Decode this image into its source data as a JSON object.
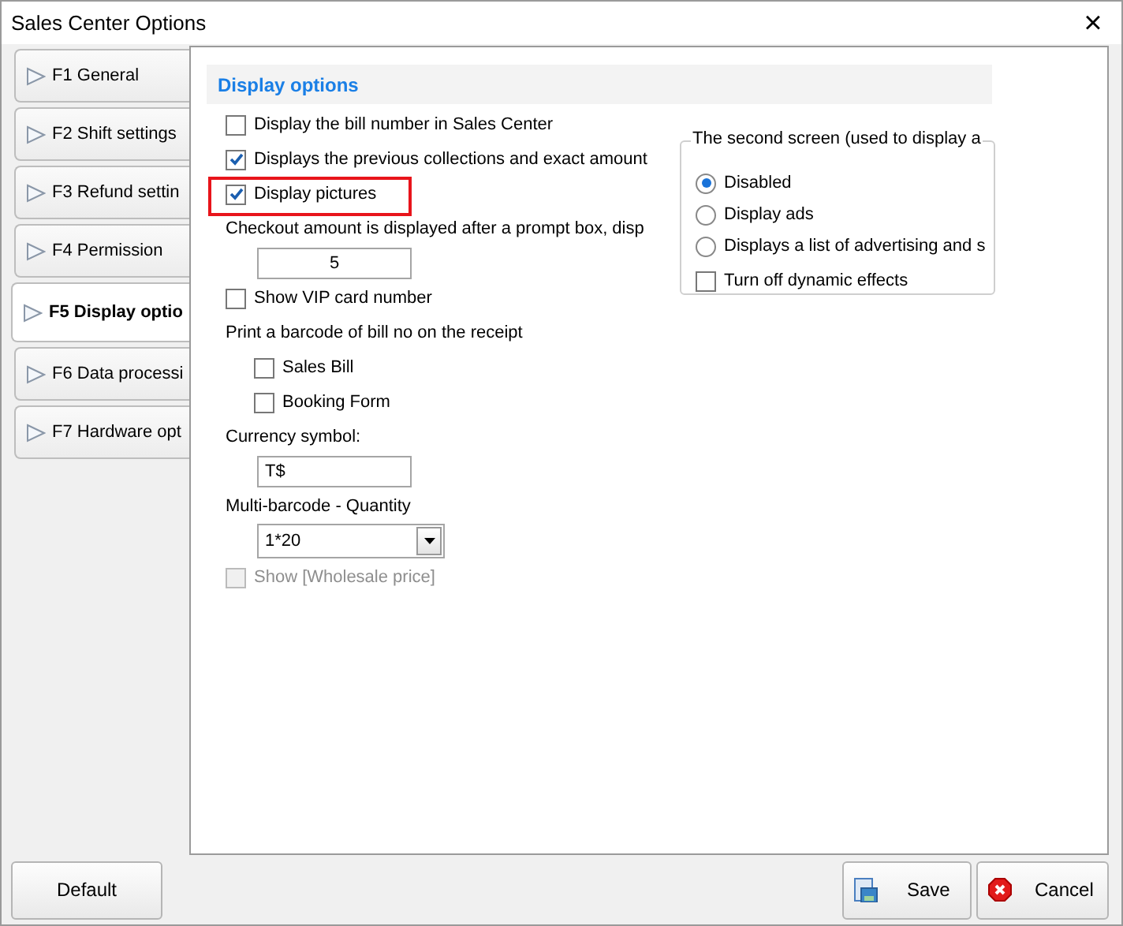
{
  "window": {
    "title": "Sales Center Options",
    "close": "×"
  },
  "tabs": [
    {
      "label": "F1 General",
      "selected": false
    },
    {
      "label": "F2 Shift settings",
      "selected": false
    },
    {
      "label": "F3 Refund settin",
      "selected": false
    },
    {
      "label": "F4 Permission",
      "selected": false
    },
    {
      "label": "F5 Display optio",
      "selected": true
    },
    {
      "label": "F6 Data processi",
      "selected": false
    },
    {
      "label": "F7 Hardware opt",
      "selected": false
    }
  ],
  "section_title": "Display options",
  "options": [
    {
      "kind": "checkbox",
      "label": "Display the bill number in Sales Center",
      "checked": false
    },
    {
      "kind": "checkbox",
      "label": "Displays the previous collections and exact amount",
      "checked": true
    },
    {
      "kind": "checkbox",
      "label": "Display pictures",
      "checked": true,
      "highlighted": true
    },
    {
      "kind": "label",
      "label": "Checkout amount is displayed after a prompt box, disp"
    },
    {
      "kind": "numberfield",
      "value": "5"
    },
    {
      "kind": "checkbox",
      "label": "Show VIP card number",
      "checked": false
    },
    {
      "kind": "label",
      "label": "Print a barcode of bill no on the receipt"
    },
    {
      "kind": "subcheckbox",
      "label": "Sales Bill",
      "checked": false
    },
    {
      "kind": "subcheckbox",
      "label": "Booking Form",
      "checked": false
    },
    {
      "kind": "label",
      "label": "Currency symbol:"
    },
    {
      "kind": "field",
      "value": "T$"
    },
    {
      "kind": "label",
      "label": "Multi-barcode - Quantity"
    },
    {
      "kind": "combo",
      "value": "1*20"
    },
    {
      "kind": "checkbox",
      "label": "Show [Wholesale price]",
      "checked": false,
      "disabled": true
    }
  ],
  "second_screen": {
    "title": "The second screen (used to display a",
    "choices": [
      {
        "label": "Disabled",
        "selected": true
      },
      {
        "label": "Display ads",
        "selected": false
      },
      {
        "label": "Displays a list of advertising and s",
        "selected": false
      }
    ],
    "dynamic_effects": {
      "label": "Turn off dynamic effects",
      "checked": false
    }
  },
  "buttons": [
    {
      "kind": "default",
      "label": "Default"
    },
    {
      "kind": "save",
      "label": "Save"
    },
    {
      "kind": "cancel",
      "label": "Cancel"
    }
  ]
}
